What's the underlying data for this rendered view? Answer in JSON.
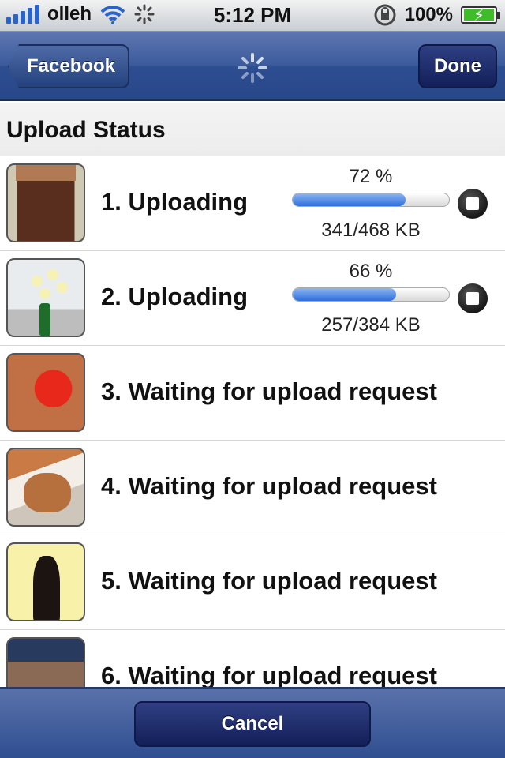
{
  "status_bar": {
    "carrier": "olleh",
    "time": "5:12 PM",
    "battery": "100%"
  },
  "nav": {
    "back_label": "Facebook",
    "done_label": "Done"
  },
  "section": {
    "title": "Upload Status"
  },
  "uploads": [
    {
      "label": "1. Uploading",
      "percent_text": "72 %",
      "progress": 0.72,
      "size_text": "341/468 KB"
    },
    {
      "label": "2. Uploading",
      "percent_text": "66 %",
      "progress": 0.66,
      "size_text": "257/384 KB"
    },
    {
      "label": "3. Waiting for upload request"
    },
    {
      "label": "4. Waiting for upload request"
    },
    {
      "label": "5. Waiting for upload request"
    },
    {
      "label": "6. Waiting for upload request"
    }
  ],
  "toolbar": {
    "cancel_label": "Cancel"
  },
  "icons": [
    "signal-icon",
    "wifi-icon",
    "activity-spinner-icon",
    "orientation-lock-icon",
    "battery-icon",
    "stop-icon"
  ],
  "colors": {
    "nav_blue": "#3b5a9b",
    "progress_blue": "#2d6fdc",
    "battery_green": "#3ebc2a"
  }
}
